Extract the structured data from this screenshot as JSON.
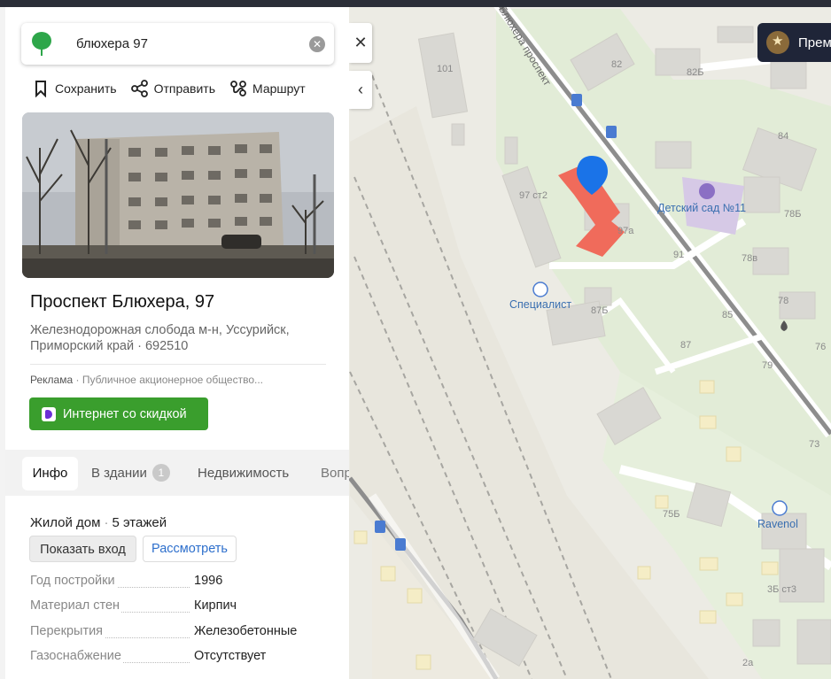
{
  "search": {
    "value": "блюхера 97",
    "placeholder": ""
  },
  "actions": {
    "save": "Сохранить",
    "share": "Отправить",
    "route": "Маршрут"
  },
  "place": {
    "title": "Проспект Блюхера, 97",
    "address": "Железнодорожная слобода м-н, Уссурийск, Приморский край · 692510"
  },
  "ad": {
    "label": "Реклама",
    "sponsor": "Публичное акционерное общество...",
    "button": "Интернет со скидкой"
  },
  "tabs": [
    {
      "label": "Инфо"
    },
    {
      "label": "В здании",
      "badge": "1"
    },
    {
      "label": "Недвижимость"
    },
    {
      "label": "Вопр"
    }
  ],
  "house": {
    "type": "Жилой дом",
    "floors": "5 этажей",
    "show_entrance": "Показать вход",
    "view": "Рассмотреть"
  },
  "properties": [
    {
      "key": "Год постройки",
      "value": "1996"
    },
    {
      "key": "Материал стен",
      "value": "Кирпич"
    },
    {
      "key": "Перекрытия",
      "value": "Железобетонные"
    },
    {
      "key": "Газоснабжение",
      "value": "Отсутствует"
    }
  ],
  "map": {
    "premium": "Прем",
    "street": "Блюхера проспект",
    "pois": {
      "kindergarten": "Детский сад №11",
      "specialist": "Специалист",
      "ravenol": "Ravenol"
    },
    "numbers": {
      "n101": "101",
      "n82": "82",
      "n82b": "82Б",
      "n84": "84",
      "n78b": "78Б",
      "n97s2": "97 ст2",
      "n97a": "97а",
      "n91": "91",
      "n78v": "78в",
      "n78": "78",
      "n87b": "87Б",
      "n85": "85",
      "n87": "87",
      "n79": "79",
      "n76": "76",
      "n73": "73",
      "n75b": "75Б",
      "n3bs3": "3Б ст3",
      "n2a": "2а"
    }
  },
  "colors": {
    "accent_green": "#3a9e2d",
    "pin_blue": "#1a73e8",
    "building_red": "#f06b5b",
    "link_blue": "#2d6fcc"
  }
}
